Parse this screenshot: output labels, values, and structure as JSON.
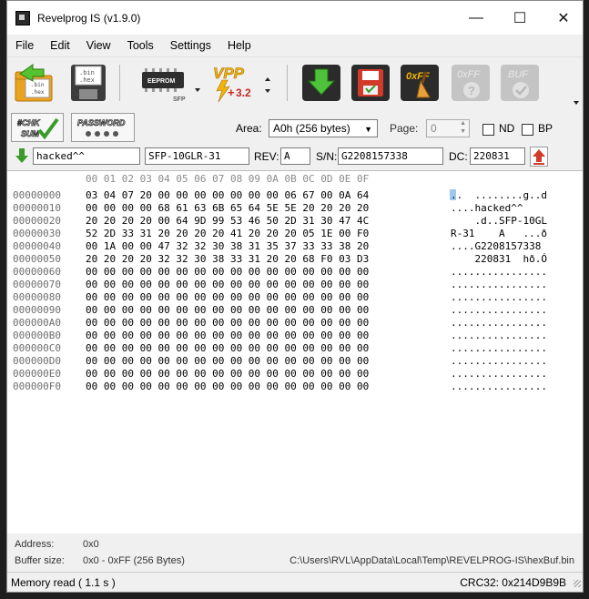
{
  "window": {
    "title": "Revelprog IS (v1.9.0)",
    "minimize": "—",
    "maximize": "☐",
    "close": "✕"
  },
  "menu": [
    "File",
    "Edit",
    "View",
    "Tools",
    "Settings",
    "Help"
  ],
  "toolbar": {
    "open_label": ".bin\n.hex",
    "eeprom_label": "EEPROM",
    "sfp_label": "SFP",
    "vpp_label": "VPP",
    "vpp_value": "3.2",
    "fill_label": "0xFF",
    "blank_label": "0xFF",
    "buf_label": "BUF"
  },
  "options": {
    "chk_sum_label": "#CHK SUM",
    "password_label": "PASSWORD",
    "password_dots": "● ● ● ●",
    "area_label": "Area:",
    "area_value": "A0h (256 bytes)",
    "page_label": "Page:",
    "page_value": "0",
    "nd_label": "ND",
    "bp_label": "BP",
    "vendor_value": "hacked^^",
    "pn_value": "SFP-10GLR-31",
    "rev_label": "REV:",
    "rev_value": "A",
    "sn_label": "S/N:",
    "sn_value": "G2208157338",
    "dc_label": "DC:",
    "dc_value": "220831"
  },
  "hex": {
    "header": "00 01 02 03 04 05 06 07 08 09 0A 0B 0C 0D 0E 0F",
    "rows": [
      {
        "offset": "00000000",
        "bytes": "03 04 07 20 00 00 00 00 00 00 00 06 67 00 0A 64",
        "ascii": "..  ........g..d"
      },
      {
        "offset": "00000010",
        "bytes": "00 00 00 00 68 61 63 6B 65 64 5E 5E 20 20 20 20",
        "ascii": "....hacked^^"
      },
      {
        "offset": "00000020",
        "bytes": "20 20 20 20 00 64 9D 99 53 46 50 2D 31 30 47 4C",
        "ascii": "    .d..SFP-10GL"
      },
      {
        "offset": "00000030",
        "bytes": "52 2D 33 31 20 20 20 20 41 20 20 20 05 1E 00 F0",
        "ascii": "R-31    A   ...ð"
      },
      {
        "offset": "00000040",
        "bytes": "00 1A 00 00 47 32 32 30 38 31 35 37 33 33 38 20",
        "ascii": "....G2208157338"
      },
      {
        "offset": "00000050",
        "bytes": "20 20 20 20 32 32 30 38 33 31 20 20 68 F0 03 D3",
        "ascii": "    220831  hð.Ó"
      },
      {
        "offset": "00000060",
        "bytes": "00 00 00 00 00 00 00 00 00 00 00 00 00 00 00 00",
        "ascii": "................"
      },
      {
        "offset": "00000070",
        "bytes": "00 00 00 00 00 00 00 00 00 00 00 00 00 00 00 00",
        "ascii": "................"
      },
      {
        "offset": "00000080",
        "bytes": "00 00 00 00 00 00 00 00 00 00 00 00 00 00 00 00",
        "ascii": "................"
      },
      {
        "offset": "00000090",
        "bytes": "00 00 00 00 00 00 00 00 00 00 00 00 00 00 00 00",
        "ascii": "................"
      },
      {
        "offset": "000000A0",
        "bytes": "00 00 00 00 00 00 00 00 00 00 00 00 00 00 00 00",
        "ascii": "................"
      },
      {
        "offset": "000000B0",
        "bytes": "00 00 00 00 00 00 00 00 00 00 00 00 00 00 00 00",
        "ascii": "................"
      },
      {
        "offset": "000000C0",
        "bytes": "00 00 00 00 00 00 00 00 00 00 00 00 00 00 00 00",
        "ascii": "................"
      },
      {
        "offset": "000000D0",
        "bytes": "00 00 00 00 00 00 00 00 00 00 00 00 00 00 00 00",
        "ascii": "................"
      },
      {
        "offset": "000000E0",
        "bytes": "00 00 00 00 00 00 00 00 00 00 00 00 00 00 00 00",
        "ascii": "................"
      },
      {
        "offset": "000000F0",
        "bytes": "00 00 00 00 00 00 00 00 00 00 00 00 00 00 00 00",
        "ascii": "................"
      }
    ]
  },
  "info": {
    "address_label": "Address:",
    "address_value": "0x0",
    "buffer_label": "Buffer size:",
    "buffer_value": "0x0 - 0xFF (256 Bytes)",
    "path": "C:\\Users\\RVL\\AppData\\Local\\Temp\\REVELPROG-IS\\hexBuf.bin"
  },
  "status": {
    "left": "Memory read ( 1.1 s )",
    "right": "CRC32: 0x214D9B9B"
  },
  "colors": {
    "accent_green": "#3a9a2a",
    "accent_red": "#d23a2a",
    "vpp_yellow": "#f2b40a",
    "selection": "#9ec6ee"
  }
}
